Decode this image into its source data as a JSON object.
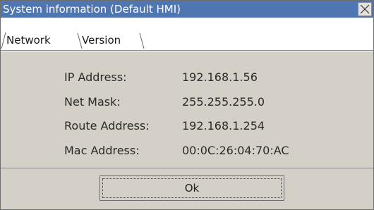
{
  "window": {
    "title": "System information (Default HMI)"
  },
  "tabs": [
    {
      "label": "Network",
      "active": true
    },
    {
      "label": "Version",
      "active": false
    }
  ],
  "network": {
    "rows": [
      {
        "label": "IP Address:",
        "value": "192.168.1.56"
      },
      {
        "label": "Net Mask:",
        "value": "255.255.255.0"
      },
      {
        "label": "Route Address:",
        "value": "192.168.1.254"
      },
      {
        "label": "Mac Address:",
        "value": "00:0C:26:04:70:AC"
      }
    ]
  },
  "footer": {
    "ok_label": "Ok"
  },
  "icons": {
    "close": "close-icon"
  },
  "colors": {
    "titlebar": "#4f76b0",
    "window_bg": "#d4d0c8"
  }
}
